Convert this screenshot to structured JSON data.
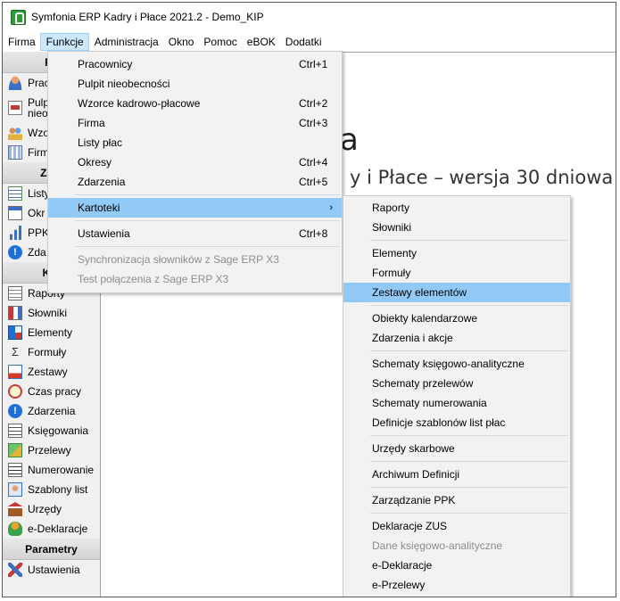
{
  "window": {
    "title": "Symfonia ERP Kadry i Płace 2021.2 - Demo_KIP",
    "icon": "symfonia-app-icon"
  },
  "menubar": {
    "items": [
      "Firma",
      "Funkcje",
      "Administracja",
      "Okno",
      "Pomoc",
      "eBOK",
      "Dodatki"
    ],
    "active": "Funkcje"
  },
  "sidebar": {
    "sections": [
      {
        "header": "Pe",
        "items": [
          {
            "label": "Prac",
            "icon": "person-icon"
          },
          {
            "label": "Pulp",
            "label2": "nieo",
            "icon": "pulpit-icon"
          },
          {
            "label": "Wzo",
            "icon": "people-icon"
          },
          {
            "label": "Firm",
            "icon": "company-icon"
          }
        ]
      },
      {
        "header": "Zarz",
        "items": [
          {
            "label": "Listy",
            "icon": "list-icon"
          },
          {
            "label": "Okr",
            "icon": "calendar-icon"
          },
          {
            "label": "PPK",
            "icon": "bars-icon"
          },
          {
            "label": "Zda",
            "icon": "info-icon"
          }
        ]
      },
      {
        "header": "Kar",
        "items": [
          {
            "label": "Raporty",
            "icon": "report-icon"
          },
          {
            "label": "Słowniki",
            "icon": "dictionary-icon"
          },
          {
            "label": "Elementy",
            "icon": "elements-icon"
          },
          {
            "label": "Formuły",
            "icon": "formula-icon"
          },
          {
            "label": "Zestawy",
            "icon": "sets-icon"
          },
          {
            "label": "Czas pracy",
            "icon": "clock-icon"
          },
          {
            "label": "Zdarzenia",
            "icon": "info-icon"
          },
          {
            "label": "Księgowania",
            "icon": "ledger-icon"
          },
          {
            "label": "Przelewy",
            "icon": "transfer-icon"
          },
          {
            "label": "Numerowanie",
            "icon": "numbering-icon"
          },
          {
            "label": "Szablony list",
            "icon": "template-icon"
          },
          {
            "label": "Urzędy",
            "icon": "office-icon"
          },
          {
            "label": "e-Deklaracje",
            "icon": "edeclaration-icon"
          }
        ]
      },
      {
        "header": "Parametry",
        "items": [
          {
            "label": "Ustawienia",
            "icon": "tools-icon"
          }
        ]
      }
    ]
  },
  "main": {
    "heading": "a",
    "subtitle": "y i Płace – wersja 30 dniowa"
  },
  "funkcje_menu": {
    "items": [
      {
        "label": "Pracownicy",
        "shortcut": "Ctrl+1"
      },
      {
        "label": "Pulpit nieobecności",
        "shortcut": ""
      },
      {
        "label": "Wzorce kadrowo-płacowe",
        "shortcut": "Ctrl+2"
      },
      {
        "label": "Firma",
        "shortcut": "Ctrl+3"
      },
      {
        "label": "Listy płac",
        "shortcut": ""
      },
      {
        "label": "Okresy",
        "shortcut": "Ctrl+4"
      },
      {
        "label": "Zdarzenia",
        "shortcut": "Ctrl+5"
      },
      {
        "label": "Kartoteki",
        "shortcut": "›"
      },
      {
        "label": "Ustawienia",
        "shortcut": "Ctrl+8"
      },
      {
        "label": "Synchronizacja słowników z Sage ERP X3",
        "shortcut": ""
      },
      {
        "label": "Test połączenia z Sage ERP X3",
        "shortcut": ""
      }
    ]
  },
  "kartoteki_menu": {
    "items": [
      "Raporty",
      "Słowniki",
      "Elementy",
      "Formuły",
      "Zestawy elementów",
      "Obiekty kalendarzowe",
      "Zdarzenia i akcje",
      "Schematy księgowo-analityczne",
      "Schematy przelewów",
      "Schematy numerowania",
      "Definicje szablonów list płac",
      "Urzędy skarbowe",
      "Archiwum Definicji",
      "Zarządzanie PPK",
      "Deklaracje ZUS",
      "Dane księgowo-analityczne",
      "e-Deklaracje",
      "e-Przelewy"
    ]
  },
  "colors": {
    "highlight": "#91c9f7",
    "menu_bg": "#f2f2f2",
    "disabled": "#8d8d8d",
    "active_menu": "#cce8ff"
  }
}
